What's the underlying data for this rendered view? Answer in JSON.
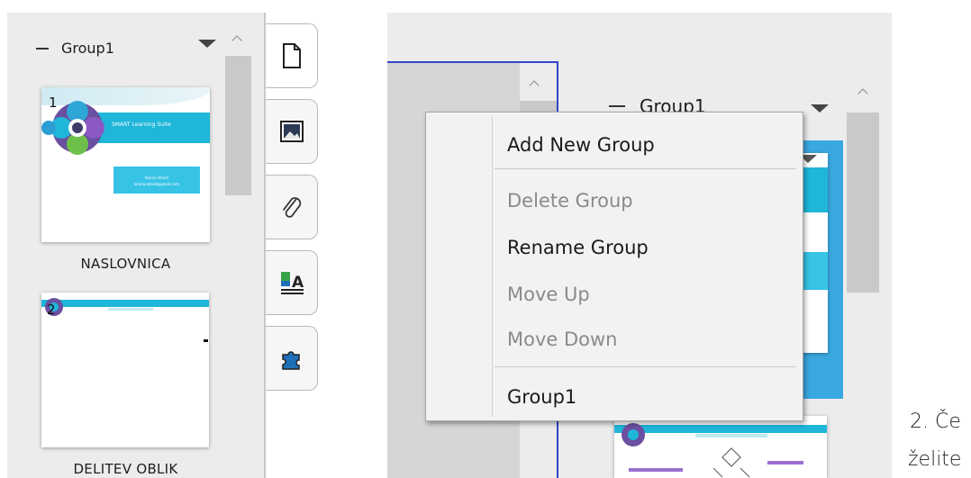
{
  "left_panel": {
    "group_label": "Group1",
    "slides": [
      {
        "number": "1",
        "label": "NASLOVNICA",
        "banner_text": "SMART Learning Suite",
        "box_line1": "Kenna Ahsell",
        "box_line2": "kenna.ahsell@gmail.com"
      },
      {
        "number": "2",
        "label": "DELITEV OBLIK"
      }
    ]
  },
  "tabs": [
    {
      "name": "page-sorter",
      "icon": "page-icon"
    },
    {
      "name": "gallery",
      "icon": "image-icon"
    },
    {
      "name": "attachments",
      "icon": "paperclip-icon"
    },
    {
      "name": "properties",
      "icon": "fill-text-icon"
    },
    {
      "name": "add-ons",
      "icon": "puzzle-icon"
    }
  ],
  "right_panel": {
    "group_label": "Group1"
  },
  "context_menu": {
    "add_new_group": "Add New Group",
    "delete_group": "Delete Group",
    "rename_group": "Rename Group",
    "move_up": "Move Up",
    "move_down": "Move Down",
    "group_item": "Group1"
  },
  "side_text": {
    "line1": "2. Če",
    "line2": "želite"
  },
  "colors": {
    "accent": "#1fb6d9",
    "selection": "#3aa8e0",
    "canvas_border": "#3344cc"
  }
}
